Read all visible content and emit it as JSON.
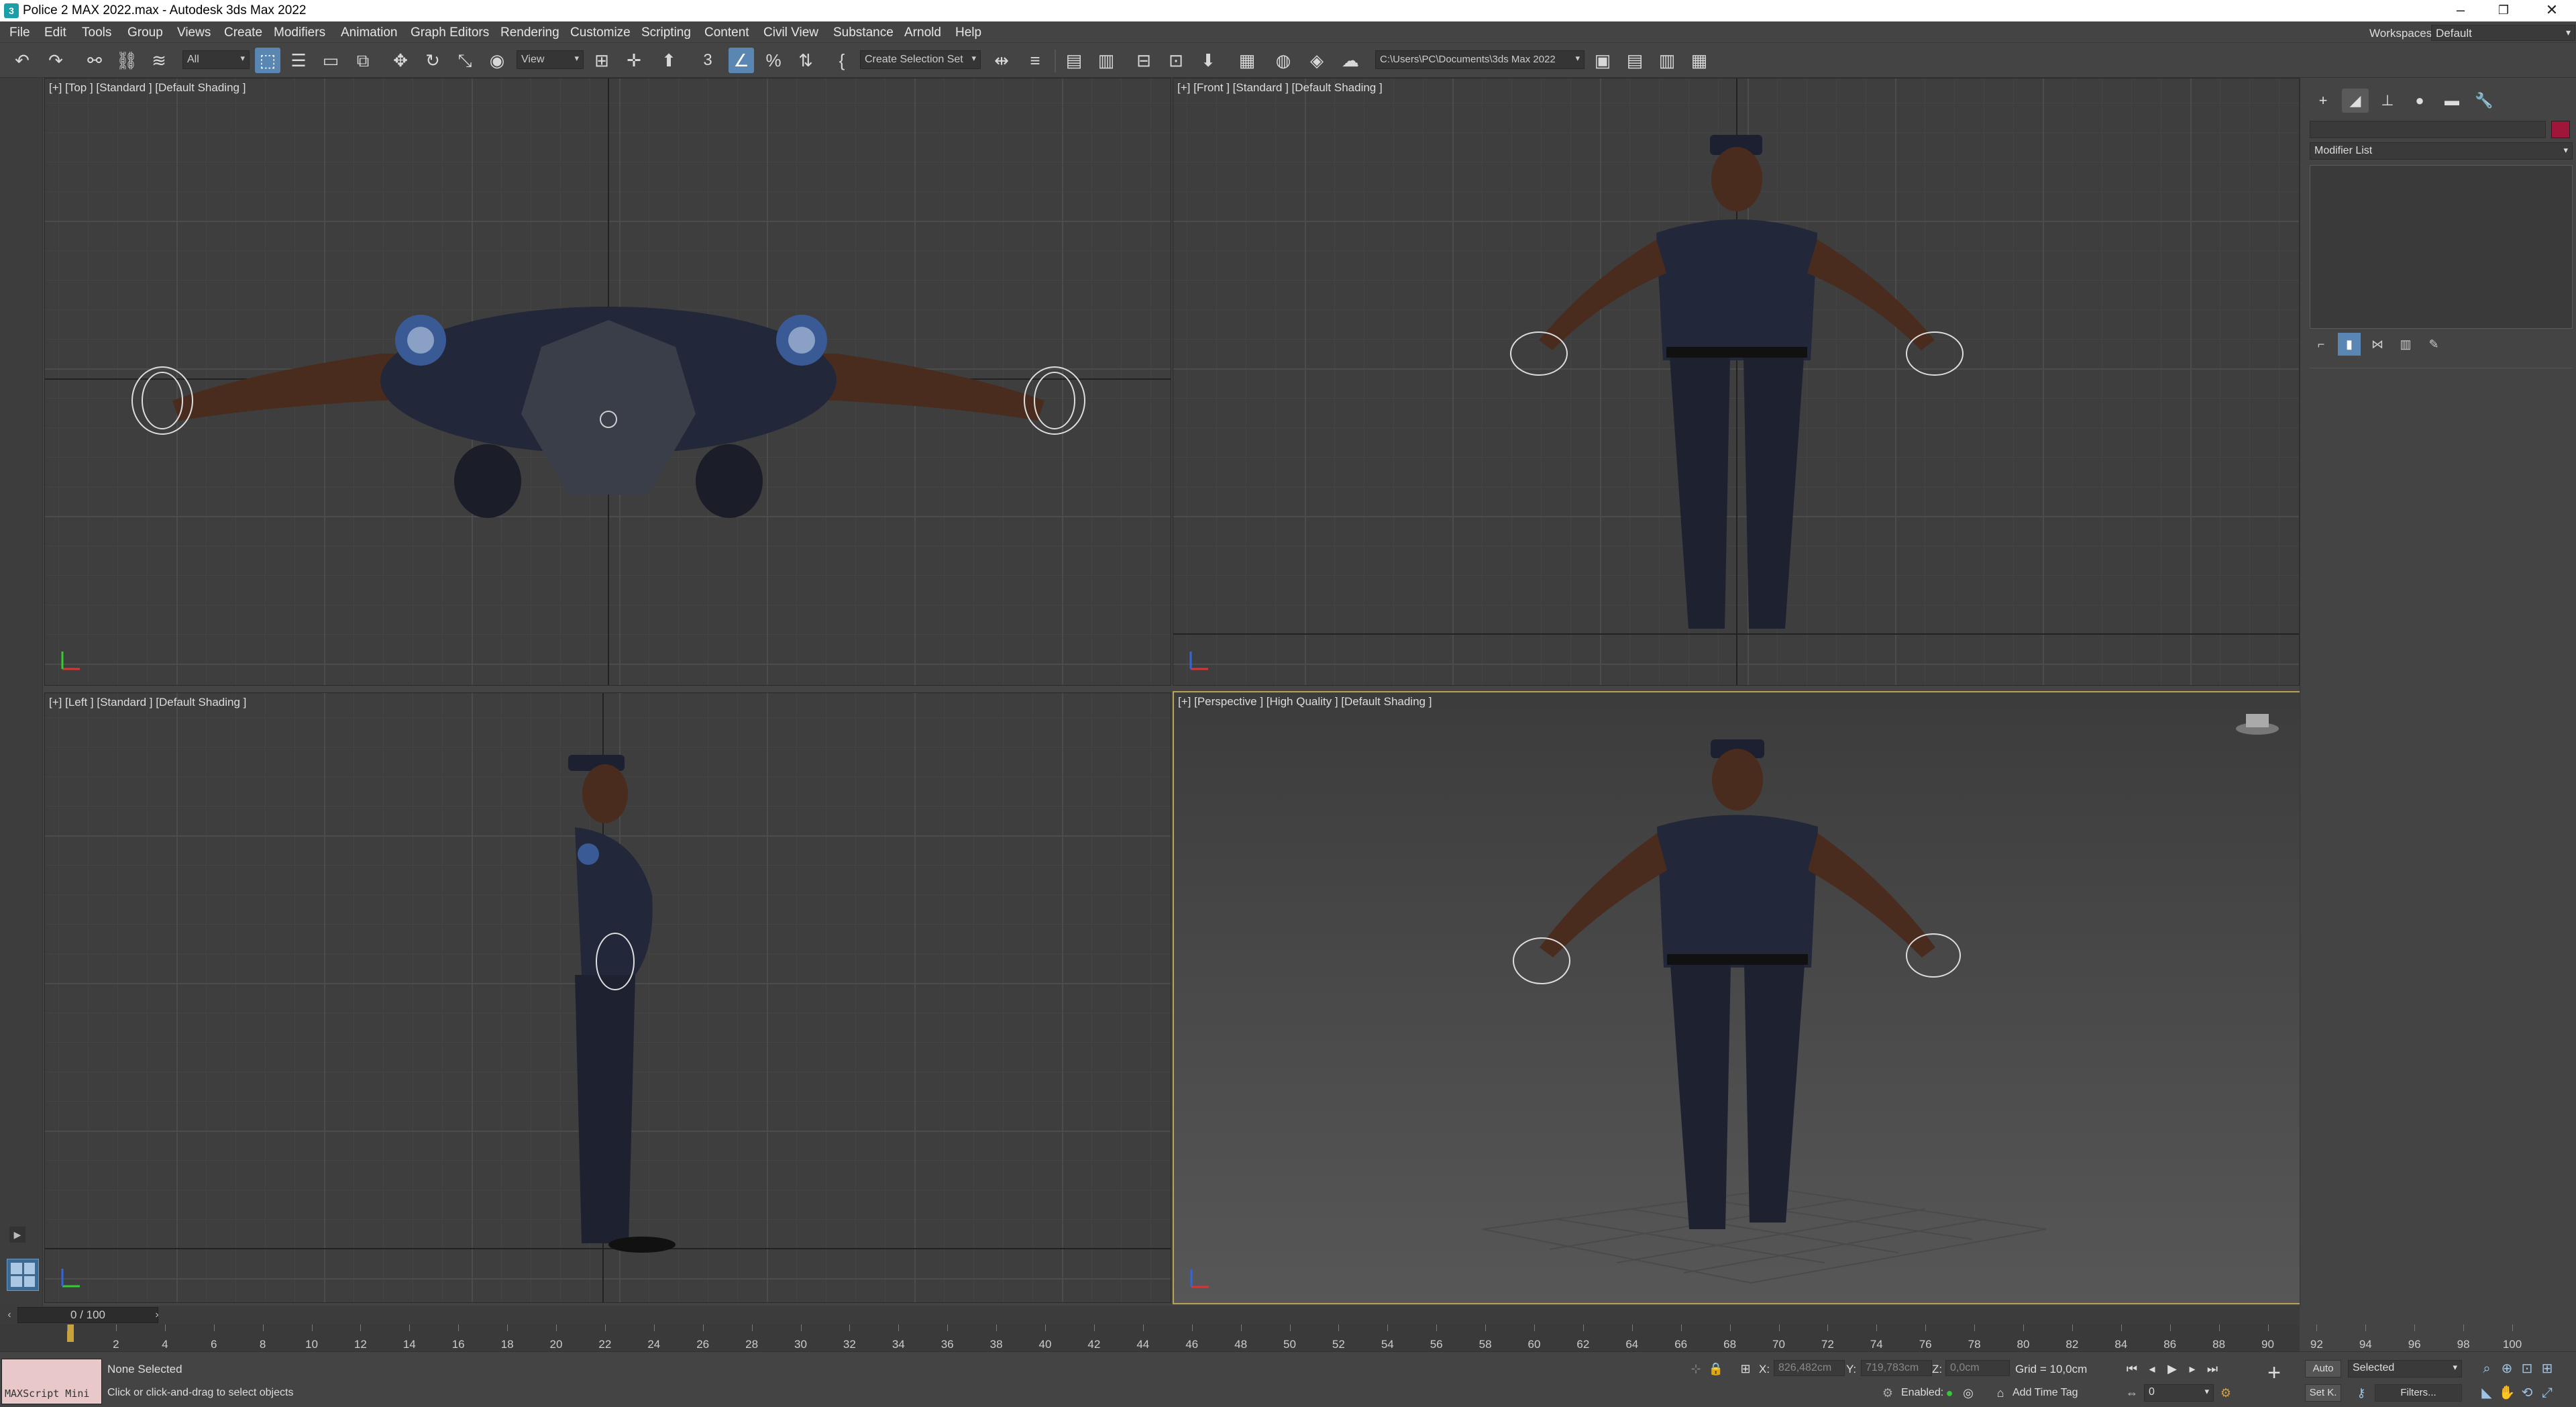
{
  "window": {
    "title": "Police 2 MAX 2022.max - Autodesk 3ds Max 2022",
    "app_icon": "3ds-max-icon"
  },
  "menubar": {
    "items": [
      "File",
      "Edit",
      "Tools",
      "Group",
      "Views",
      "Create",
      "Modifiers",
      "Animation",
      "Graph Editors",
      "Rendering",
      "Customize",
      "Scripting",
      "Content",
      "Civil View",
      "Substance",
      "Arnold",
      "Help"
    ],
    "workspaces_label": "Workspaces:",
    "workspaces_value": "Default"
  },
  "toolbar": {
    "selection_filter": "All",
    "ref_coord": "View",
    "snap_label": "3",
    "named_selection": "Create Selection Set",
    "project_path": "C:\\Users\\PC\\Documents\\3ds Max 2022"
  },
  "viewports": {
    "top": {
      "label": "[+] [Top ] [Standard ] [Default Shading ]"
    },
    "front": {
      "label": "[+] [Front ] [Standard ] [Default Shading ]"
    },
    "left": {
      "label": "[+] [Left ] [Standard ] [Default Shading ]"
    },
    "perspective": {
      "label": "[+] [Perspective ] [High Quality ] [Default Shading ]"
    }
  },
  "command_panel": {
    "modifier_list": "Modifier List",
    "object_color": "#a0163a"
  },
  "timeline": {
    "frame_display": "0 / 100",
    "ticks": [
      "0",
      "2",
      "4",
      "6",
      "8",
      "10",
      "12",
      "14",
      "16",
      "18",
      "20",
      "22",
      "24",
      "26",
      "28",
      "30",
      "32",
      "34",
      "36",
      "38",
      "40",
      "42",
      "44",
      "46",
      "48",
      "50",
      "52",
      "54",
      "56",
      "58",
      "60",
      "62",
      "64",
      "66",
      "68",
      "70",
      "72",
      "74",
      "76",
      "78",
      "80",
      "82",
      "84",
      "86",
      "88",
      "90",
      "92",
      "94",
      "96",
      "98",
      "100"
    ]
  },
  "status": {
    "maxscript": "MAXScript Mini",
    "selection": "None Selected",
    "prompt": "Click or click-and-drag to select objects",
    "x_label": "X:",
    "x_value": "826,482cm",
    "y_label": "Y:",
    "y_value": "719,783cm",
    "z_label": "Z:",
    "z_value": "0,0cm",
    "grid": "Grid = 10,0cm",
    "enabled_label": "Enabled:",
    "add_time_tag": "Add Time Tag",
    "auto": "Auto",
    "set_key": "Set K.",
    "key_filter": "Selected",
    "filters": "Filters...",
    "current_frame": "0"
  },
  "colors": {
    "accent": "#5a86b4",
    "active_viewport_border": "#b7a255",
    "uniform": "#22283a",
    "skin": "#4a2c1e"
  }
}
